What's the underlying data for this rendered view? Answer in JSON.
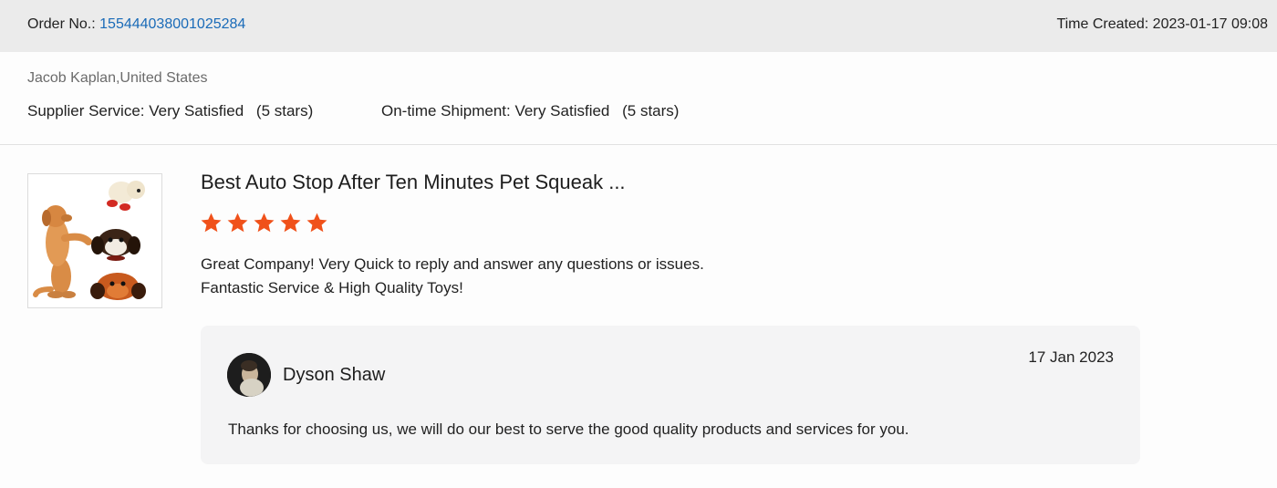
{
  "order": {
    "label": "Order No.:",
    "number": "155444038001025284",
    "time_created_label": "Time Created:",
    "time_created": "2023-01-17 09:08"
  },
  "buyer": {
    "name_location": "Jacob Kaplan,United States",
    "supplier_service": {
      "label": "Supplier Service: Very Satisfied",
      "stars": "(5 stars)"
    },
    "ontime_shipment": {
      "label": "On-time Shipment: Very Satisfied",
      "stars": "(5 stars)"
    }
  },
  "review": {
    "product_title": "Best Auto Stop After Ten Minutes Pet Squeak ...",
    "rating": 5,
    "max_rating": 5,
    "star_color": "#f0511a",
    "text_line1": "Great Company! Very Quick to reply and answer any questions or issues.",
    "text_line2": "Fantastic Service & High Quality Toys!"
  },
  "reply": {
    "name": "Dyson Shaw",
    "date": "17 Jan 2023",
    "text": "Thanks for choosing us, we will do our best to serve the good quality products and services for you."
  },
  "colors": {
    "header_bg": "#ebebeb",
    "link": "#1a6bb8",
    "card_bg": "#f4f4f5"
  }
}
